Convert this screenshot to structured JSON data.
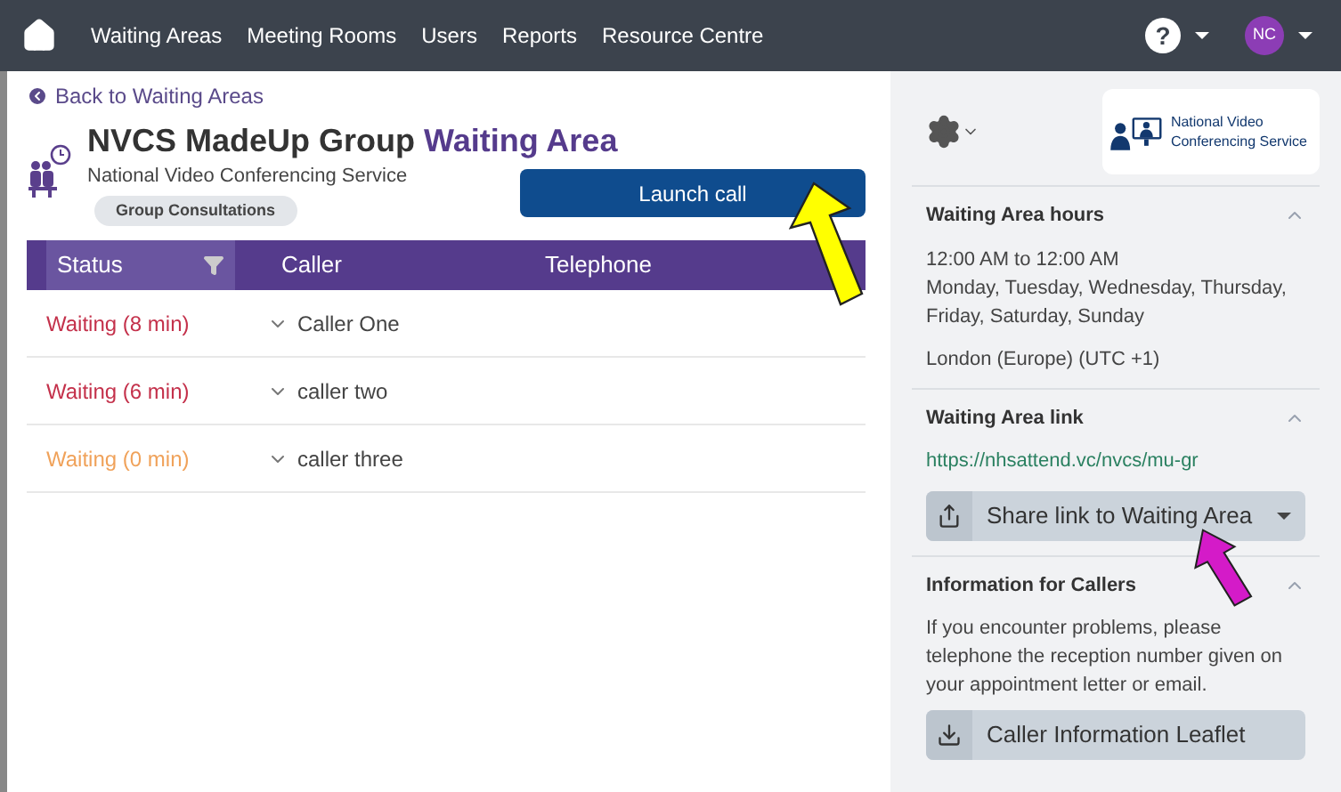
{
  "nav": {
    "items": [
      "Waiting Areas",
      "Meeting Rooms",
      "Users",
      "Reports",
      "Resource Centre"
    ],
    "help": "?",
    "avatar": "NC"
  },
  "back_link": "Back to Waiting Areas",
  "title": {
    "name": "NVCS MadeUp Group",
    "suffix": "Waiting Area",
    "subtitle": "National Video Conferencing Service",
    "badge": "Group Consultations"
  },
  "launch_button": "Launch call",
  "table": {
    "columns": [
      "Status",
      "Caller",
      "Telephone"
    ],
    "rows": [
      {
        "status": "Waiting (8 min)",
        "color": "#c4314b",
        "caller": "Caller One"
      },
      {
        "status": "Waiting (6 min)",
        "color": "#c4314b",
        "caller": "caller two"
      },
      {
        "status": "Waiting (0 min)",
        "color": "#f0a25a",
        "caller": "caller three"
      }
    ]
  },
  "sidebar": {
    "logo_text": "National Video Conferencing Service",
    "sections": [
      {
        "kind": "hours",
        "title": "Waiting Area hours",
        "expanded": true,
        "lines": [
          "12:00 AM to 12:00 AM",
          "Monday, Tuesday, Wednesday, Thursday, Friday, Saturday, Sunday"
        ],
        "timezone": "London (Europe) (UTC +1)"
      },
      {
        "kind": "link",
        "title": "Waiting Area link",
        "expanded": true,
        "url": "https://nhsattend.vc/nvcs/mu-gr",
        "button": "Share link to Waiting Area"
      },
      {
        "kind": "info",
        "title": "Information for Callers",
        "expanded": true,
        "text": "If you encounter problems, please telephone the reception number given on your appointment letter or email.",
        "button": "Caller Information Leaflet"
      }
    ]
  }
}
